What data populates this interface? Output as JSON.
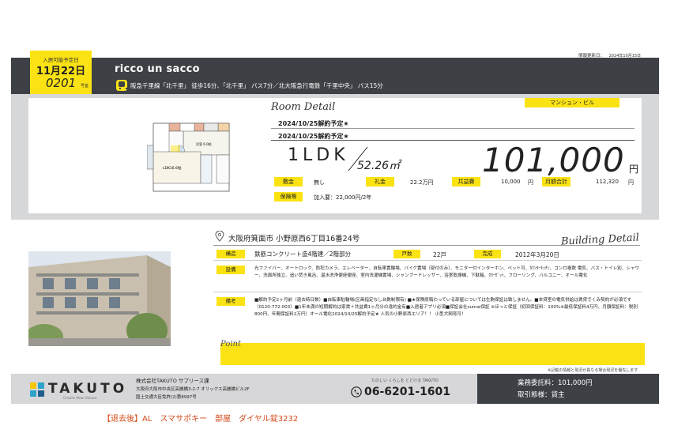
{
  "info": {
    "label": "情報更新日：",
    "date": "2024年10月15日"
  },
  "tag": {
    "label": "入居可能予定日",
    "date": "11月22日",
    "room": "0201",
    "room_suffix": "号室"
  },
  "header": {
    "property_name": "ricco un sacco",
    "access": "阪急千里線「北千里」 徒歩16分、「北千里」 バス7分／北大阪急行電鉄「千里中央」 バス15分"
  },
  "room": {
    "section_title": "Room Detail",
    "category": "マンション・ビル",
    "notice1": "2024/10/25解約予定★",
    "notice2": "2024/10/25解約予定★",
    "layout": "1LDK",
    "area": "52.26㎡",
    "rent": "101,000",
    "yen": "円",
    "deposit_label": "敷金",
    "deposit": "無し",
    "key_money_label": "礼金",
    "key_money": "22.2万円",
    "common_fee_label": "共益費",
    "common_fee": "10,000",
    "common_fee_unit": "円",
    "monthly_total_label": "月額合計",
    "monthly_total": "112,320",
    "monthly_total_unit": "円",
    "guarantor_label": "保険等",
    "guarantor": "加入要：22,000円/2年"
  },
  "building": {
    "section_title": "Building Detail",
    "address": "大阪府箕面市 小野原西6丁目16番24号",
    "structure_label": "構造",
    "structure": "鉄筋コンクリート造4階建／2階部分",
    "units_label": "戸数",
    "units": "22戸",
    "completed_label": "完成",
    "completed": "2012年3月20日",
    "facilities_label": "設備",
    "facilities": "光ファイバー、オートロック、防犯カメラ、エレベーター、自転車置輪場、バイク置場（部付のみ）、モニター付インターホン、ペット可、ｶｳﾝﾀｰｷｯﾁﾝ、コンロ複数 電気、バス・トイレ別、シャワー、洗面所独立、追い焚き風呂、温水洗浄便座便座、室内洗濯機置場、シャンプードレッサー、浴室乾燥機、下駄箱、ｸﾛｰｾﾞｯﾄ、フローリング、バルコニー、オール電化",
    "remarks_label": "備考",
    "remarks": "■解約予定2ヶ月前（退去時日数）■自転車駐輪場(区画指定なし台数制限有) ■★保険原稿わっている部屋については生駒保証は致しません。■本貸室の電気供給は賃貸でくみ契約が必須です（0120-772-003）■1年未満の短期解約は家賃＋共益費1ヶ月分の違約金有■入居者アプリ必須■保証会社sumai保証 ※ほっと保証（初回保証料：100%※最低保証料4万円、月額保証料：税別800円、年間保証料2万円）オール電化2024/10/25解約予定★ 人気の小野原西エリア！！ 小型犬飼育可！",
    "point_label": "Point"
  },
  "notice_footer": "※記載の情報と現況が異なる場合現況を優先します",
  "footer": {
    "brand": "TAKUTO",
    "tagline": "Create New Values",
    "company": "株式会社TAKUTO サプリース課",
    "address": "大阪府大阪市中央区高麗橋3-2-7 オリックス高麗橋ビル2F",
    "license": "国土交通大臣免許(2)第8997号",
    "phone_message": "たのしい くらしを とどける TAKUTO",
    "phone": "06-6201-1601",
    "fee_line": "業務委託料：101,000円",
    "deal_line": "取引態様：貸主"
  },
  "memo": "【退去後】AL　スマサポキー　部屋　ダイヤル錠3232",
  "colors": {
    "accent": "#fbe313",
    "dark": "#3d4145",
    "memo": "#d34a1a"
  }
}
